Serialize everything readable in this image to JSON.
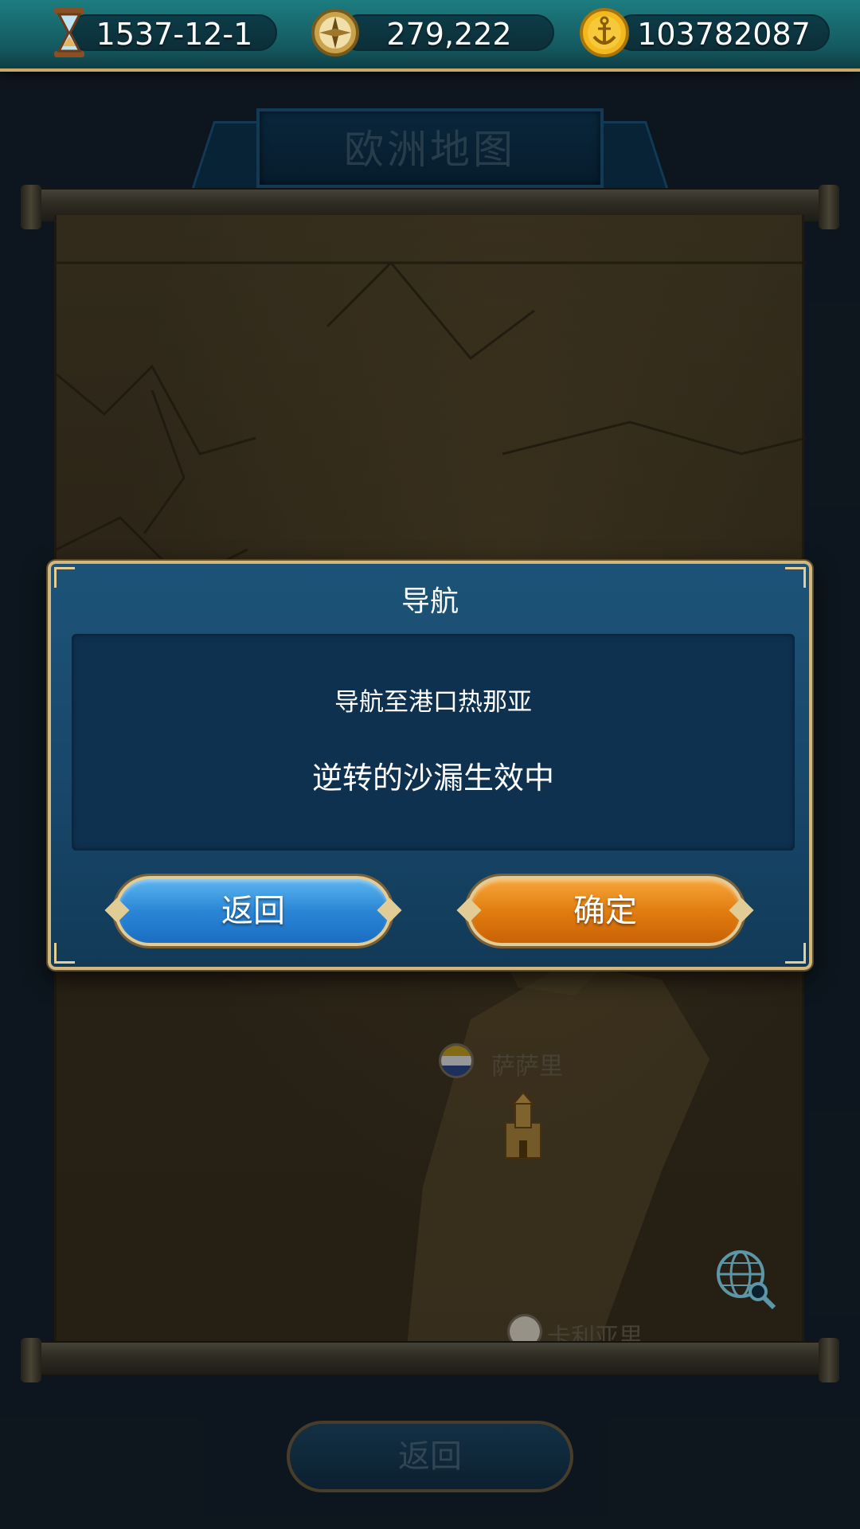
{
  "topbar": {
    "date": "1537-12-1",
    "compass_value": "279,222",
    "gold": "103782087"
  },
  "map": {
    "title": "欧洲地图",
    "cities": [
      {
        "name": "萨萨里"
      },
      {
        "name": "卡利亚里"
      }
    ],
    "back_label": "返回"
  },
  "dialog": {
    "title": "导航",
    "message": "导航至港口热那亚",
    "status": "逆转的沙漏生效中",
    "back_label": "返回",
    "confirm_label": "确定"
  },
  "icons": {
    "date": "hourglass-icon",
    "compass": "compass-icon",
    "gold": "anchor-coin-icon",
    "globe": "globe-search-icon",
    "castle": "castle-icon"
  },
  "colors": {
    "dialog_bg": "#174668",
    "dialog_border": "#d4b77c",
    "back_button": "#2b86d6",
    "confirm_button": "#e27d10"
  }
}
